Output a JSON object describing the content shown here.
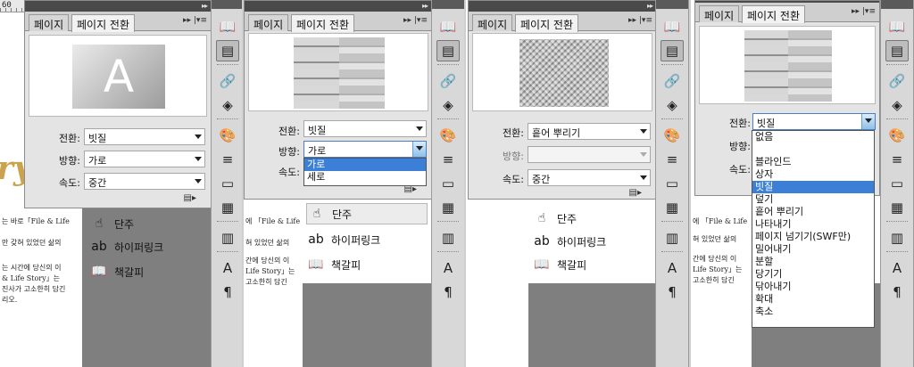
{
  "panel": {
    "tab_pages": "페이지",
    "tab_transition": "페이지 전환",
    "label_transition": "전환:",
    "label_direction": "방향:",
    "label_speed": "속도:"
  },
  "frames": [
    {
      "transition": "빗질",
      "direction": "가로",
      "speed": "중간",
      "preview": "A"
    },
    {
      "transition": "빗질",
      "direction": "가로",
      "speed": "",
      "dropdown": [
        "가로",
        "세로"
      ]
    },
    {
      "transition": "흩어 뿌리기",
      "direction": "",
      "speed": "중간"
    },
    {
      "transition": "빗질",
      "direction": "",
      "speed": "",
      "dropdown": [
        "없음",
        "블라인드",
        "상자",
        "빗질",
        "덮기",
        "흩어 뿌리기",
        "나타내기",
        "페이지 넘기기(SWF만)",
        "밀어내기",
        "분할",
        "당기기",
        "닦아내기",
        "확대",
        "축소"
      ]
    }
  ],
  "menu": {
    "columns": "단주",
    "hyperlink": "하이퍼링크",
    "bookmark": "책갈피"
  },
  "doc": {
    "ruler": "60",
    "lines": [
      "는 바로「File & Life",
      "만 갖혀 있었던 삶의",
      "는 시간에 당신의 이",
      "& Life Story」는",
      "진사가 고소한히 담긴",
      "리오."
    ],
    "lines2": [
      "에 「File & Life",
      "혀 있었던 삶의",
      "간에 당신의 이",
      "Life Story」는",
      "고소한히 담긴"
    ],
    "deco": "ry"
  }
}
